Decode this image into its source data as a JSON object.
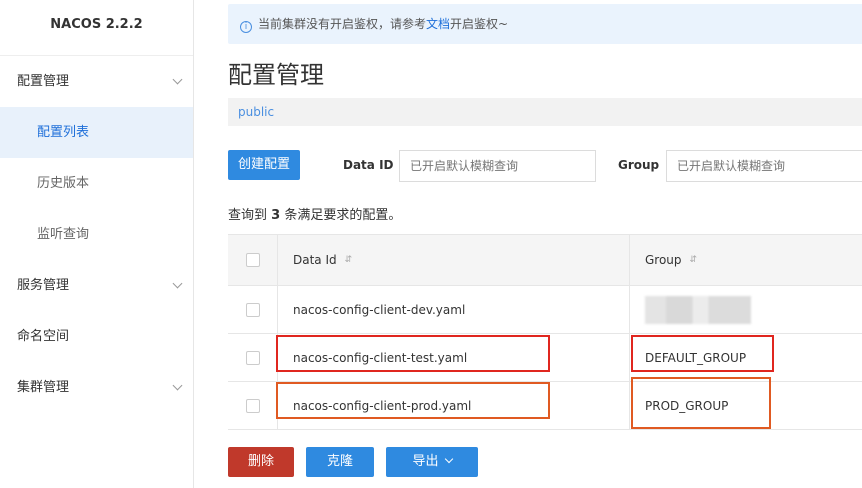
{
  "sidebar": {
    "brand": "NACOS 2.2.2",
    "items": [
      {
        "label": "配置管理",
        "type": "group",
        "expandable": true
      },
      {
        "label": "配置列表",
        "type": "sub",
        "active": true
      },
      {
        "label": "历史版本",
        "type": "sub"
      },
      {
        "label": "监听查询",
        "type": "sub"
      },
      {
        "label": "服务管理",
        "type": "group",
        "expandable": true
      },
      {
        "label": "命名空间",
        "type": "group"
      },
      {
        "label": "集群管理",
        "type": "group",
        "expandable": true
      }
    ]
  },
  "notice": {
    "text_before": "当前集群没有开启鉴权，请参考",
    "link": "文档",
    "text_after": "开启鉴权~",
    "icon": "info-icon"
  },
  "page": {
    "title": "配置管理",
    "namespace": "public"
  },
  "toolbar": {
    "create_label": "创建配置",
    "dataid_label": "Data ID",
    "dataid_placeholder": "已开启默认模糊查询",
    "group_label": "Group",
    "group_placeholder": "已开启默认模糊查询"
  },
  "result": {
    "prefix": "查询到",
    "count": "3",
    "suffix": "条满足要求的配置。"
  },
  "table": {
    "headers": {
      "data_id": "Data Id",
      "group": "Group"
    },
    "rows": [
      {
        "data_id": "nacos-config-client-dev.yaml",
        "group": "",
        "group_obscured": true
      },
      {
        "data_id": "nacos-config-client-test.yaml",
        "group": "DEFAULT_GROUP"
      },
      {
        "data_id": "nacos-config-client-prod.yaml",
        "group": "PROD_GROUP"
      }
    ]
  },
  "actions": {
    "delete_label": "删除",
    "clone_label": "克隆",
    "export_label": "导出"
  },
  "colors": {
    "primary": "#2f8ae0",
    "danger": "#c0392b",
    "highlight": "#e0261f"
  }
}
